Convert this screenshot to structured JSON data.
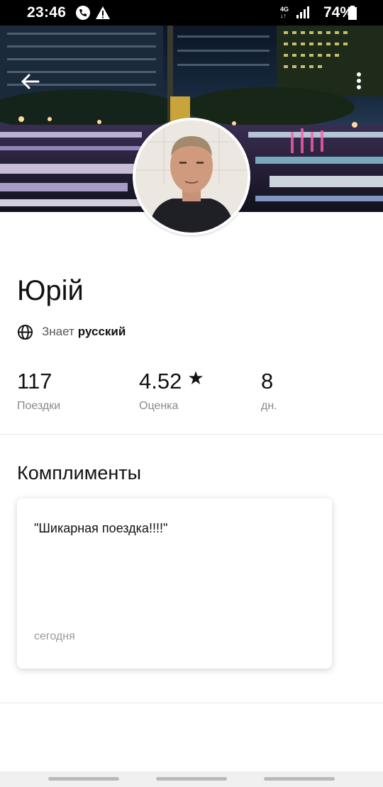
{
  "status_bar": {
    "time": "23:46",
    "network": "4G",
    "battery": "74%",
    "icons": [
      "phone-call-icon",
      "warning-icon",
      "network-4g-icon",
      "signal-icon",
      "battery-icon"
    ]
  },
  "header": {
    "back_icon": "arrow-left-icon",
    "menu_icon": "more-vertical-icon"
  },
  "profile": {
    "name": "Юрій",
    "language_label": "Знает",
    "language_value": "русский",
    "language_icon": "globe-icon"
  },
  "stats": [
    {
      "value": "117",
      "label": "Поездки"
    },
    {
      "value": "4.52",
      "suffix": "★",
      "label": "Оценка"
    },
    {
      "value": "8",
      "label": "дн."
    }
  ],
  "compliments": {
    "title": "Комплименты",
    "items": [
      {
        "text": "\"Шикарная поездка!!!!\"",
        "time": "сегодня"
      }
    ]
  },
  "colors": {
    "text_primary": "#111111",
    "text_secondary": "#8a8a8a",
    "divider": "#e4e4e4"
  }
}
